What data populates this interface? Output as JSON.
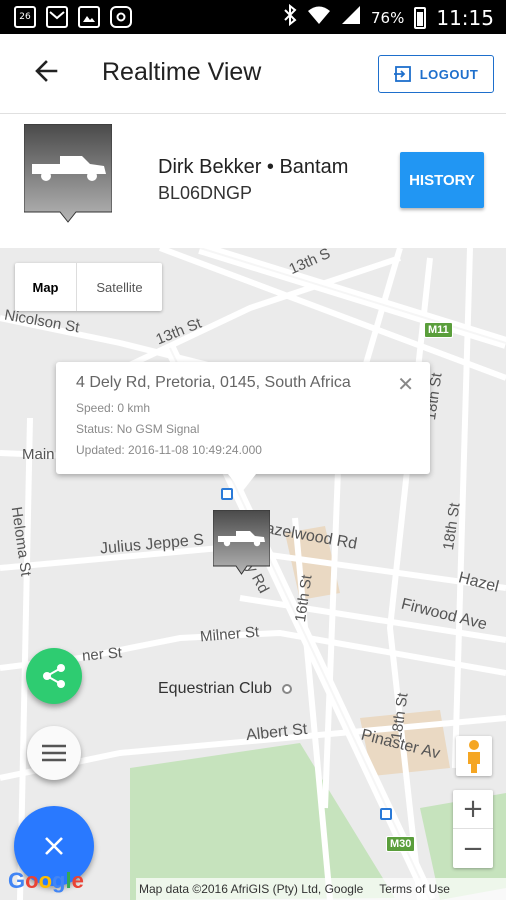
{
  "status_bar": {
    "icons_left": [
      "weather-icon",
      "mail-icon",
      "gallery-icon",
      "instagram-icon"
    ],
    "weather_text": "26",
    "battery_percent": "76%",
    "time": "11:15"
  },
  "header": {
    "title": "Realtime View",
    "logout_label": "LOGOUT"
  },
  "vehicle": {
    "name": "Dirk Bekker • Bantam",
    "plate": "BL06DNGP",
    "history_label": "HISTORY"
  },
  "map": {
    "type_control": {
      "map_label": "Map",
      "satellite_label": "Satellite",
      "selected": "Map"
    },
    "info_window": {
      "address": "4 Dely Rd, Pretoria, 0145, South Africa",
      "close_glyph": "✕",
      "speed": "Speed: 0 kmh",
      "status": "Status: No GSM Signal",
      "updated": "Updated: 2016-11-08 10:49:24.000"
    },
    "street_labels": {
      "nicolson": "Nicolson St",
      "thirteenth_a": "13th St",
      "thirteenth_b": "13th S",
      "main": "Main",
      "heloma": "Heloma St",
      "julius": "Julius Jeppe S",
      "hazelwood": "azelwood Rd",
      "dely": "y Rd",
      "sixteenth": "16th St",
      "eighteenth_a": "18th St",
      "eighteenth_b": "18th St",
      "eighteenth_c": "18th St",
      "firwood": "Firwood Ave",
      "hazel": "Hazel",
      "milner_a": "Milner St",
      "milner_b": "ner St",
      "albert": "Albert St",
      "pinaster": "Pinaster Av",
      "m11": "M11",
      "m30": "M30"
    },
    "poi_label": "Equestrian Club",
    "zoom_in": "+",
    "zoom_out": "−",
    "google_logo": "Google",
    "attribution": "Map data ©2016 AfriGIS (Pty) Ltd, Google",
    "terms": "Terms of Use"
  },
  "fabs": {
    "share": "share-icon",
    "menu": "menu-icon",
    "close": "close-icon"
  },
  "colors": {
    "accent": "#2196f3",
    "fab_share": "#2ecc71",
    "fab_close": "#2979ff",
    "park": "#c8e6c0",
    "block": "#ecdcc6"
  }
}
